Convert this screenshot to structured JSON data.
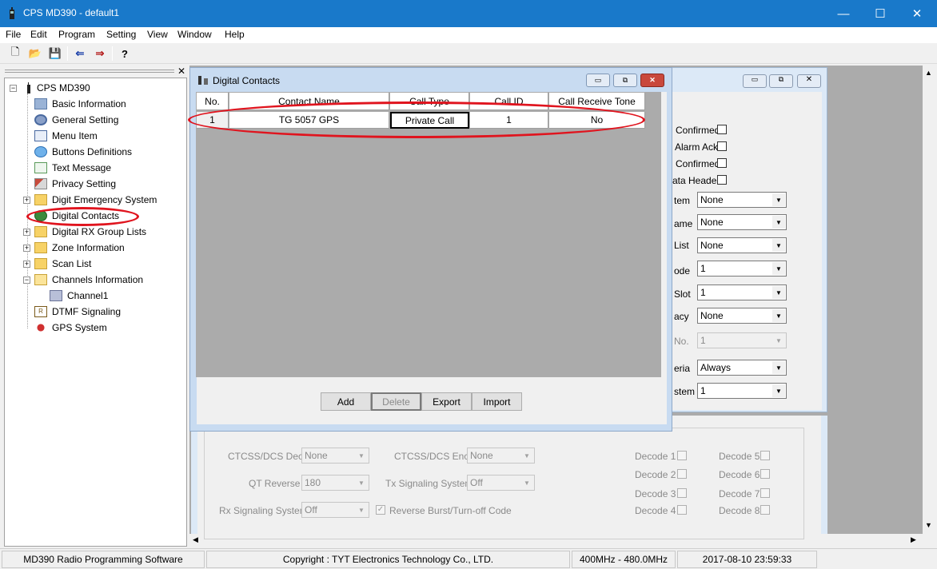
{
  "window": {
    "title": "CPS MD390 - default1",
    "minimize": "—",
    "maximize": "☐",
    "close": "✕"
  },
  "menu": [
    "File",
    "Edit",
    "Program",
    "Setting",
    "View",
    "Window",
    "Help"
  ],
  "toolbar": {
    "new": "🗋",
    "open": "📂",
    "save": "💾",
    "read": "⇐",
    "write": "⇒",
    "help": "?"
  },
  "tree": {
    "root": "CPS MD390",
    "items": [
      {
        "label": "Basic Information",
        "icon": "basic-info-icon"
      },
      {
        "label": "General Setting",
        "icon": "gear-icon"
      },
      {
        "label": "Menu Item",
        "icon": "menu-item-icon"
      },
      {
        "label": "Buttons Definitions",
        "icon": "button-icon"
      },
      {
        "label": "Text Message",
        "icon": "message-icon"
      },
      {
        "label": "Privacy Setting",
        "icon": "key-icon"
      },
      {
        "label": "Digit Emergency System",
        "icon": "folder-icon"
      },
      {
        "label": "Digital Contacts",
        "icon": "contacts-icon"
      },
      {
        "label": "Digital RX Group Lists",
        "icon": "folder-icon"
      },
      {
        "label": "Zone Information",
        "icon": "folder-icon"
      },
      {
        "label": "Scan List",
        "icon": "folder-icon"
      },
      {
        "label": "Channels Information",
        "icon": "folder-open-icon"
      },
      {
        "label": "Channel1",
        "icon": "channel-icon"
      },
      {
        "label": "DTMF Signaling",
        "icon": "dtmf-icon"
      },
      {
        "label": "GPS System",
        "icon": "gps-icon"
      }
    ]
  },
  "digital_contacts": {
    "title": "Digital Contacts",
    "columns": [
      "No.",
      "Contact Name",
      "Call Type",
      "Call ID",
      "Call Receive Tone"
    ],
    "rows": [
      [
        "1",
        "TG 5057 GPS",
        "Private Call",
        "1",
        "No"
      ]
    ],
    "buttons": {
      "add": "Add",
      "delete": "Delete",
      "export": "Export",
      "import": "Import"
    }
  },
  "channel_panel": {
    "checks": [
      "Confirmed",
      "Alarm Ack",
      "Confirmed",
      "ata Header"
    ],
    "fields": [
      {
        "label": "tem",
        "value": "None"
      },
      {
        "label": "ame",
        "value": "None"
      },
      {
        "label": "List",
        "value": "None"
      },
      {
        "label": "ode",
        "value": "1"
      },
      {
        "label": "Slot",
        "value": "1"
      },
      {
        "label": "acy",
        "value": "None"
      },
      {
        "label": "No.",
        "value": "1"
      },
      {
        "label": "eria",
        "value": "Always"
      },
      {
        "label": "stem",
        "value": "1"
      }
    ],
    "ctcss_dec": {
      "label": "CTCSS/DCS Dec",
      "value": "None"
    },
    "ctcss_enc": {
      "label": "CTCSS/DCS Enc",
      "value": "None"
    },
    "qt_reverse": {
      "label": "QT Reverse",
      "value": "180"
    },
    "tx_signaling": {
      "label": "Tx Signaling System",
      "value": "Off"
    },
    "rx_signaling": {
      "label": "Rx Signaling System",
      "value": "Off"
    },
    "reverse_burst": "Reverse Burst/Turn-off Code",
    "decodes": [
      "Decode 1",
      "Decode 5",
      "Decode 2",
      "Decode 6",
      "Decode 3",
      "Decode 7",
      "Decode 4",
      "Decode 8"
    ]
  },
  "status": {
    "app": "MD390 Radio Programming Software",
    "copyright": "Copyright : TYT Electronics Technology Co., LTD.",
    "band": "400MHz - 480.0MHz",
    "datetime": "2017-08-10 23:59:33"
  },
  "colors": {
    "titlebar": "#1979ca",
    "highlight": "#e0141e",
    "mdi": "#ababab"
  }
}
